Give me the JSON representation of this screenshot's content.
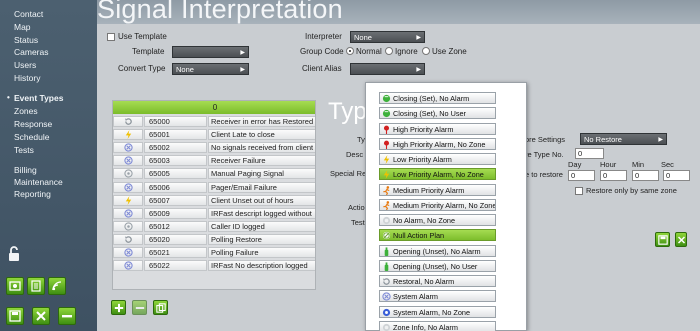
{
  "sidebar": {
    "items": [
      {
        "label": "Contact"
      },
      {
        "label": "Map"
      },
      {
        "label": "Status"
      },
      {
        "label": "Cameras"
      },
      {
        "label": "Users"
      },
      {
        "label": "History"
      },
      {
        "label": "Event Types"
      },
      {
        "label": "Zones"
      },
      {
        "label": "Response"
      },
      {
        "label": "Schedule"
      },
      {
        "label": "Tests"
      },
      {
        "label": "Billing"
      },
      {
        "label": "Maintenance"
      },
      {
        "label": "Reporting"
      }
    ]
  },
  "page": {
    "title": "Signal Interpretation"
  },
  "form": {
    "use_template_label": "Use Template",
    "template_label": "Template",
    "template_value": "",
    "convert_type_label": "Convert Type",
    "convert_type_value": "None",
    "interpreter_label": "Interpreter",
    "interpreter_value": "None",
    "group_code_label": "Group Code",
    "radio_normal": "Normal",
    "radio_ignore": "Ignore",
    "radio_use_zone": "Use Zone",
    "client_alias_label": "Client Alias",
    "client_alias_value": ""
  },
  "event_list": {
    "header": "0",
    "rows": [
      {
        "code": "65000",
        "desc": "Receiver in error has Restored",
        "icon": "restore-icon"
      },
      {
        "code": "65001",
        "desc": "Client Late to close",
        "icon": "lightning-icon"
      },
      {
        "code": "65002",
        "desc": "No signals received from client",
        "icon": "system-icon"
      },
      {
        "code": "65003",
        "desc": "Receiver Failure",
        "icon": "system-icon"
      },
      {
        "code": "65005",
        "desc": "Manual Paging Signal",
        "icon": "info-icon"
      },
      {
        "code": "65006",
        "desc": "Pager/Email Failure",
        "icon": "system-icon"
      },
      {
        "code": "65007",
        "desc": "Client Unset out of hours",
        "icon": "lightning-icon"
      },
      {
        "code": "65009",
        "desc": "IRFast descript logged without",
        "icon": "system-icon"
      },
      {
        "code": "65012",
        "desc": "Caller ID logged",
        "icon": "info-icon"
      },
      {
        "code": "65020",
        "desc": "Polling Restore",
        "icon": "restore-icon"
      },
      {
        "code": "65021",
        "desc": "Polling Failure",
        "icon": "system-icon"
      },
      {
        "code": "65022",
        "desc": "IRFast No description logged",
        "icon": "system-icon"
      }
    ]
  },
  "details": {
    "heading": "Typ",
    "ty_label": "Ty",
    "desc_label": "Desc",
    "special_label": "Special Re",
    "action_label": "Action",
    "test_label": "Test",
    "restore_settings_label": "ore Settings",
    "restore_settings_value": "No Restore",
    "restore_type_label": "re Type No.",
    "restore_type_value": "0",
    "restore_to_label": "e to restore",
    "day_label": "Day",
    "hour_label": "Hour",
    "min_label": "Min",
    "sec_label": "Sec",
    "day_value": "0",
    "hour_value": "0",
    "min_value": "0",
    "sec_value": "0",
    "restore_same_zone_label": "Restore only by same zone"
  },
  "popup": {
    "items": [
      {
        "label": "Closing (Set), No Alarm",
        "icon": "green-dot-icon",
        "color": "#3db13a"
      },
      {
        "label": "Closing (Set), No User",
        "icon": "green-dot-icon",
        "color": "#3db13a"
      },
      {
        "label": "High Priority Alarm",
        "icon": "red-pin-icon",
        "color": "#d22020"
      },
      {
        "label": "High Priority Alarm, No Zone",
        "icon": "red-pin-icon",
        "color": "#d22020"
      },
      {
        "label": "Low Priority Alarm",
        "icon": "lightning-icon",
        "color": "#f0c000"
      },
      {
        "label": "Low Priority Alarm, No Zone",
        "icon": "lightning-icon",
        "color": "#f0c000",
        "selected": true
      },
      {
        "label": "Medium Priority Alarm",
        "icon": "runner-icon",
        "color": "#e87a10"
      },
      {
        "label": "Medium Priority Alarm, No Zone",
        "icon": "runner-icon",
        "color": "#e87a10"
      },
      {
        "label": "No Alarm, No Zone",
        "icon": "grey-dot-icon",
        "color": "#cfd3d6"
      },
      {
        "label": "Null Action Plan",
        "icon": "null-icon",
        "color": "#6da632",
        "selected": true
      },
      {
        "label": "Opening (Unset), No Alarm",
        "icon": "green-bottle-icon",
        "color": "#3db13a"
      },
      {
        "label": "Opening (Unset), No User",
        "icon": "green-bottle-icon",
        "color": "#3db13a"
      },
      {
        "label": "Restoral, No Alarm",
        "icon": "restore-icon",
        "color": "#9aa2a9"
      },
      {
        "label": "System Alarm",
        "icon": "system-icon",
        "color": "#3a5fd8"
      },
      {
        "label": "System Alarm, No Zone",
        "icon": "system-blue-icon",
        "color": "#3a5fd8"
      },
      {
        "label": "Zone Info, No Alarm",
        "icon": "grey-dot-icon",
        "color": "#cfd3d6"
      }
    ]
  },
  "colors": {
    "accent_green": "#7dbd2c",
    "sidebar_bg": "#455869",
    "main_bg": "#c9cdd1"
  }
}
